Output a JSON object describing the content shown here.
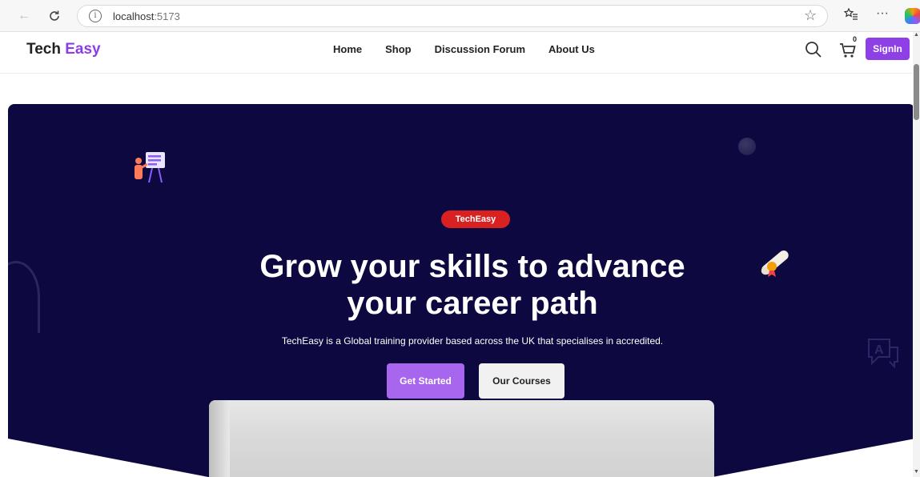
{
  "browser": {
    "url_host": "localhost",
    "url_port": ":5173"
  },
  "header": {
    "logo_part1": "Tech",
    "logo_part2": "Easy",
    "nav": [
      "Home",
      "Shop",
      "Discussion Forum",
      "About Us"
    ],
    "cart_count": "0",
    "signin_label": "SignIn"
  },
  "hero": {
    "badge": "TechEasy",
    "headline_line1": "Grow your skills to advance",
    "headline_line2": "your career path",
    "subtext": "TechEasy is a Global training provider based across the UK that specialises in accredited.",
    "primary_button": "Get Started",
    "secondary_button": "Our Courses"
  },
  "colors": {
    "brand_purple": "#8f3fe6",
    "hero_background": "#0d0840",
    "badge_red": "#d92121"
  },
  "icons": [
    "back-icon",
    "reload-icon",
    "info-icon",
    "star-icon",
    "favorites-icon",
    "more-icon",
    "search-icon",
    "cart-icon",
    "teacher-presentation-icon",
    "diploma-icon",
    "translate-icon"
  ]
}
